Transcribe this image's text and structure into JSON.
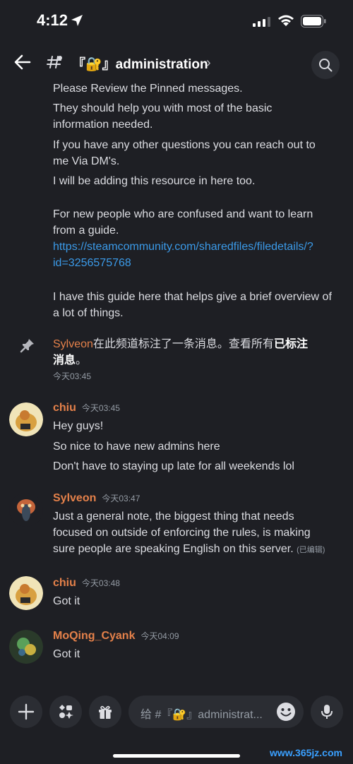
{
  "status_bar": {
    "time": "4:12"
  },
  "header": {
    "hash": "#",
    "channel_name": "『🔐』administration",
    "chevron": "›"
  },
  "pinned_content": {
    "lines": [
      "Please Review the Pinned messages.",
      "They should help you with most of the basic",
      "information needed.",
      "If you have any other questions you can reach out to",
      "me Via DM's.",
      "I will be adding this resource in here too.",
      "For new people who are confused and want to learn",
      "from a guide.",
      "https://steamcommunity.com/sharedfiles/filedetails/?",
      "id=3256575768",
      "I have this guide here that helps give a brief overview of",
      "a lot of things."
    ]
  },
  "system_message": {
    "user": "Sylveon",
    "text": "在此频道标注了一条消息。查看所有",
    "link_text": "已标注",
    "link_text2": "消息",
    "end": "。",
    "time": "今天03:45"
  },
  "messages": [
    {
      "user": "chiu",
      "time": "今天03:45",
      "lines": [
        "Hey guys!",
        "So nice to have new admins here",
        "Don't have to staying up late for all weekends lol"
      ]
    },
    {
      "user": "Sylveon",
      "time": "今天03:47",
      "lines": [
        "Just a general note, the biggest thing that needs",
        "focused on outside of enforcing the rules, is making",
        "sure people are speaking English on this server."
      ],
      "edited": "(已编辑)"
    },
    {
      "user": "chiu",
      "time": "今天03:48",
      "lines": [
        "Got it"
      ]
    },
    {
      "user": "MoQing_Cyank",
      "time": "今天04:09",
      "lines": [
        "Got it"
      ]
    }
  ],
  "composer": {
    "placeholder": "给 #『🔐』administrat..."
  },
  "watermark": "www.365jz.com"
}
